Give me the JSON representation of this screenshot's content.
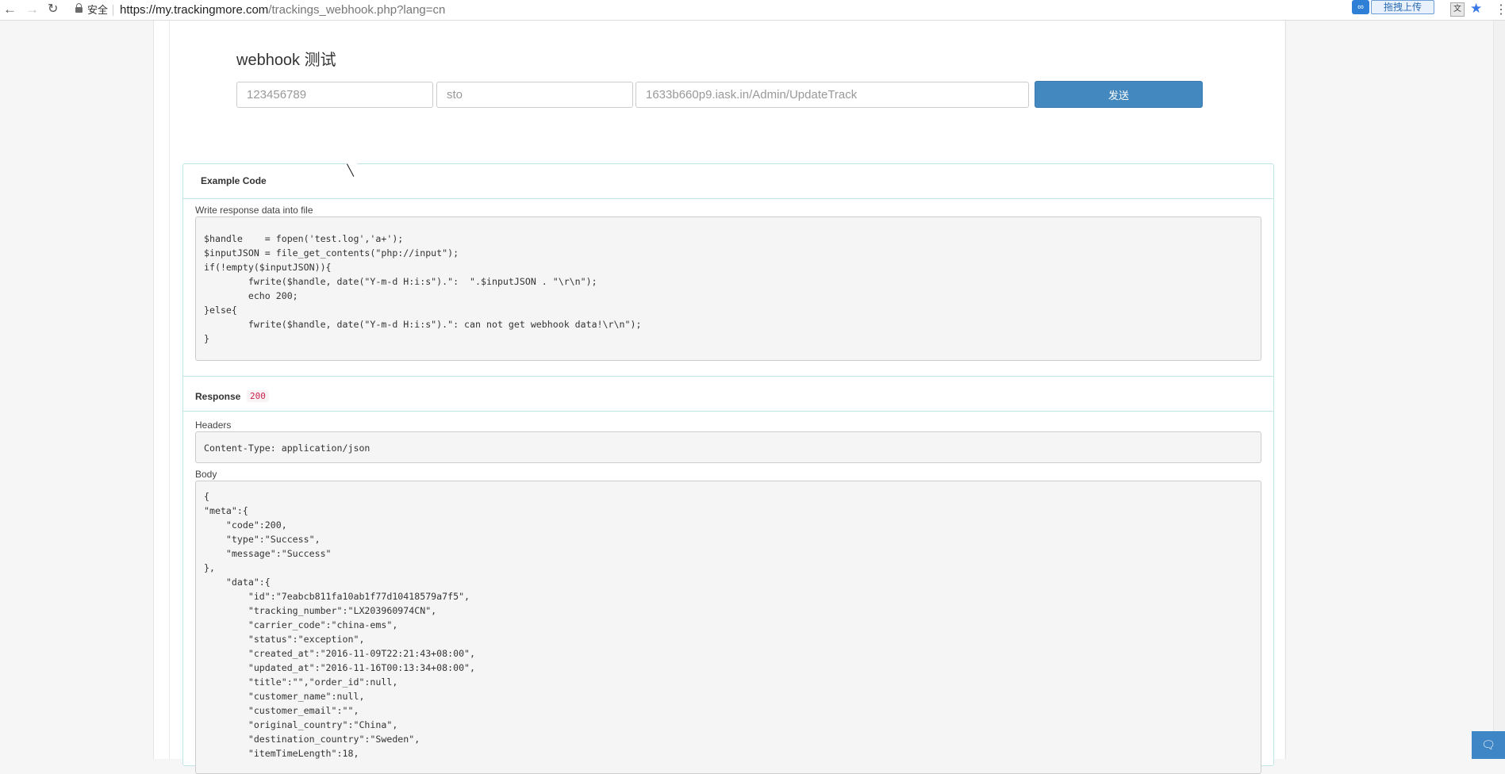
{
  "browser": {
    "secure_label": "安全",
    "url_host": "https://my.trackingmore.com",
    "url_path": "/trackings_webhook.php?lang=cn",
    "extension_upload_label": "拖拽上传"
  },
  "webhook_test": {
    "title": "webhook 测试",
    "tracking_number_placeholder": "123456789",
    "carrier_placeholder": "sto",
    "url_placeholder": "1633b660p9.iask.in/Admin/UpdateTrack",
    "send_label": "发送"
  },
  "example_code": {
    "heading": "Example Code",
    "description": "Write response data into file",
    "code": "$handle    = fopen('test.log','a+');\n$inputJSON = file_get_contents(\"php://input\");\nif(!empty($inputJSON)){\n        fwrite($handle, date(\"Y-m-d H:i:s\").\":  \".$inputJSON . \"\\r\\n\");\n        echo 200;\n}else{\n        fwrite($handle, date(\"Y-m-d H:i:s\").\": can not get webhook data!\\r\\n\");\n}"
  },
  "response": {
    "heading": "Response",
    "status_code": "200",
    "headers_label": "Headers",
    "headers_value": "Content-Type: application/json",
    "body_label": "Body",
    "body": "{\n\"meta\":{\n    \"code\":200,\n    \"type\":\"Success\",\n    \"message\":\"Success\"\n},\n    \"data\":{\n        \"id\":\"7eabcb811fa10ab1f77d10418579a7f5\",\n        \"tracking_number\":\"LX203960974CN\",\n        \"carrier_code\":\"china-ems\",\n        \"status\":\"exception\",\n        \"created_at\":\"2016-11-09T22:21:43+08:00\",\n        \"updated_at\":\"2016-11-16T00:13:34+08:00\",\n        \"title\":\"\",\"order_id\":null,\n        \"customer_name\":null,\n        \"customer_email\":\"\",\n        \"original_country\":\"China\",\n        \"destination_country\":\"Sweden\",\n        \"itemTimeLength\":18,"
  },
  "colors": {
    "accent_button": "#4388bf",
    "panel_border": "#bfe6e6",
    "status_code_text": "#c7254e"
  },
  "icons": [
    "back-arrow-icon",
    "forward-arrow-icon",
    "reload-icon",
    "lock-icon",
    "cloud-extension-icon",
    "translate-icon",
    "star-icon",
    "menu-icon",
    "chat-icon"
  ]
}
